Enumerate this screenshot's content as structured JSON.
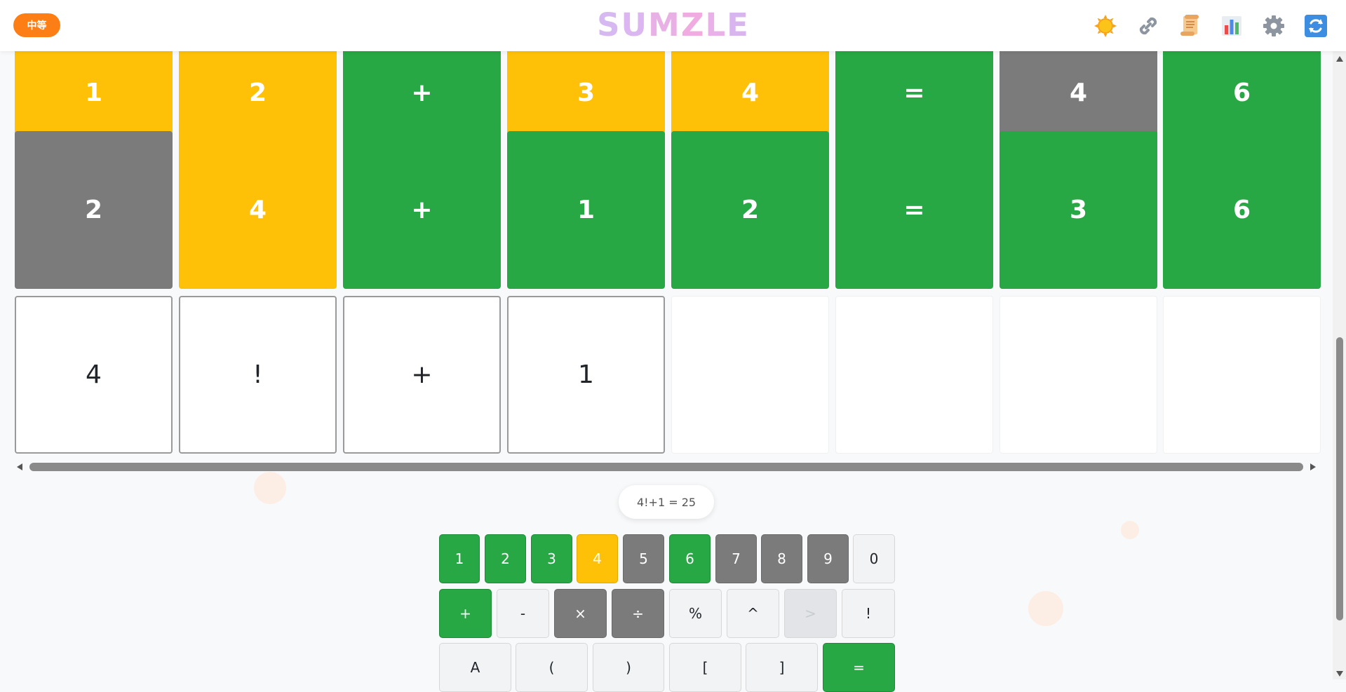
{
  "header": {
    "difficulty": "中等",
    "logo_letters": [
      "S",
      "U",
      "M",
      "Z",
      "L",
      "E"
    ]
  },
  "board": {
    "rows": [
      [
        {
          "value": "1",
          "state": "yellow"
        },
        {
          "value": "2",
          "state": "yellow"
        },
        {
          "value": "+",
          "state": "green"
        },
        {
          "value": "3",
          "state": "yellow"
        },
        {
          "value": "4",
          "state": "yellow"
        },
        {
          "value": "=",
          "state": "green"
        },
        {
          "value": "4",
          "state": "gray"
        },
        {
          "value": "6",
          "state": "green"
        }
      ],
      [
        {
          "value": "2",
          "state": "gray"
        },
        {
          "value": "4",
          "state": "yellow"
        },
        {
          "value": "+",
          "state": "green"
        },
        {
          "value": "1",
          "state": "green"
        },
        {
          "value": "2",
          "state": "green"
        },
        {
          "value": "=",
          "state": "green"
        },
        {
          "value": "3",
          "state": "green"
        },
        {
          "value": "6",
          "state": "green"
        }
      ],
      [
        {
          "value": "4",
          "state": "input"
        },
        {
          "value": "!",
          "state": "input"
        },
        {
          "value": "+",
          "state": "input"
        },
        {
          "value": "1",
          "state": "input"
        },
        {
          "value": "",
          "state": "empty"
        },
        {
          "value": "",
          "state": "empty"
        },
        {
          "value": "",
          "state": "empty"
        },
        {
          "value": "",
          "state": "empty"
        }
      ]
    ]
  },
  "preview": {
    "expression": "4!+1 = 25"
  },
  "keyboard": {
    "rows": [
      [
        {
          "label": "1",
          "state": "green"
        },
        {
          "label": "2",
          "state": "green"
        },
        {
          "label": "3",
          "state": "green"
        },
        {
          "label": "4",
          "state": "yellow"
        },
        {
          "label": "5",
          "state": "gray"
        },
        {
          "label": "6",
          "state": "green"
        },
        {
          "label": "7",
          "state": "gray"
        },
        {
          "label": "8",
          "state": "gray"
        },
        {
          "label": "9",
          "state": "gray"
        },
        {
          "label": "0",
          "state": "default"
        }
      ],
      [
        {
          "label": "+",
          "state": "green"
        },
        {
          "label": "-",
          "state": "default"
        },
        {
          "label": "×",
          "state": "gray"
        },
        {
          "label": "÷",
          "state": "gray"
        },
        {
          "label": "%",
          "state": "default"
        },
        {
          "label": "^",
          "state": "default"
        },
        {
          "label": ">",
          "state": "disabled"
        },
        {
          "label": "!",
          "state": "default"
        }
      ],
      [
        {
          "label": "A",
          "state": "default"
        },
        {
          "label": "(",
          "state": "default"
        },
        {
          "label": ")",
          "state": "default"
        },
        {
          "label": "[",
          "state": "default"
        },
        {
          "label": "]",
          "state": "default"
        },
        {
          "label": "=",
          "state": "green"
        }
      ]
    ]
  },
  "icons": [
    "theme-sun-icon",
    "share-link-icon",
    "rules-scroll-icon",
    "stats-chart-icon",
    "settings-gear-icon",
    "refresh-icon"
  ],
  "colors": {
    "correct": "#28a745",
    "present": "#ffc107",
    "absent": "#7b7b7b",
    "difficulty_badge": "#fd7e14"
  }
}
